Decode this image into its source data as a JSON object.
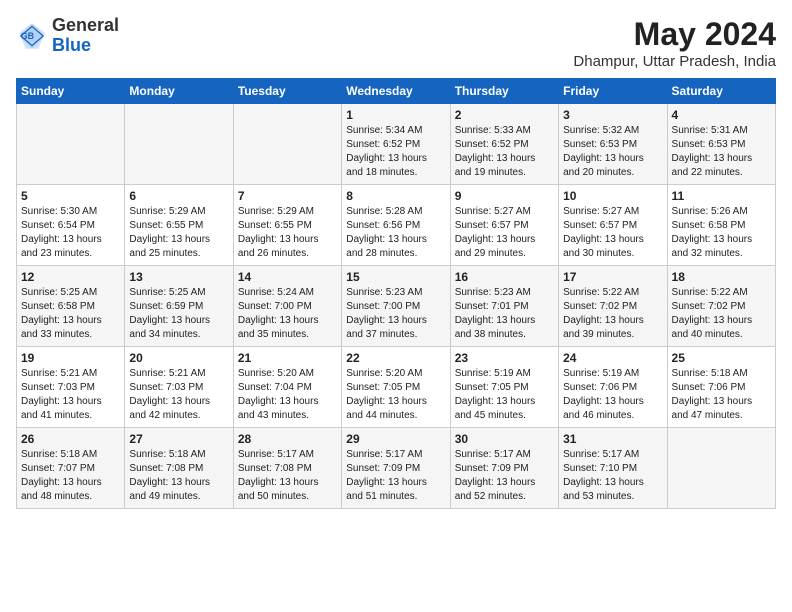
{
  "header": {
    "logo_general": "General",
    "logo_blue": "Blue",
    "month_title": "May 2024",
    "location": "Dhampur, Uttar Pradesh, India"
  },
  "weekdays": [
    "Sunday",
    "Monday",
    "Tuesday",
    "Wednesday",
    "Thursday",
    "Friday",
    "Saturday"
  ],
  "weeks": [
    [
      {
        "day": "",
        "info": ""
      },
      {
        "day": "",
        "info": ""
      },
      {
        "day": "",
        "info": ""
      },
      {
        "day": "1",
        "info": "Sunrise: 5:34 AM\nSunset: 6:52 PM\nDaylight: 13 hours\nand 18 minutes."
      },
      {
        "day": "2",
        "info": "Sunrise: 5:33 AM\nSunset: 6:52 PM\nDaylight: 13 hours\nand 19 minutes."
      },
      {
        "day": "3",
        "info": "Sunrise: 5:32 AM\nSunset: 6:53 PM\nDaylight: 13 hours\nand 20 minutes."
      },
      {
        "day": "4",
        "info": "Sunrise: 5:31 AM\nSunset: 6:53 PM\nDaylight: 13 hours\nand 22 minutes."
      }
    ],
    [
      {
        "day": "5",
        "info": "Sunrise: 5:30 AM\nSunset: 6:54 PM\nDaylight: 13 hours\nand 23 minutes."
      },
      {
        "day": "6",
        "info": "Sunrise: 5:29 AM\nSunset: 6:55 PM\nDaylight: 13 hours\nand 25 minutes."
      },
      {
        "day": "7",
        "info": "Sunrise: 5:29 AM\nSunset: 6:55 PM\nDaylight: 13 hours\nand 26 minutes."
      },
      {
        "day": "8",
        "info": "Sunrise: 5:28 AM\nSunset: 6:56 PM\nDaylight: 13 hours\nand 28 minutes."
      },
      {
        "day": "9",
        "info": "Sunrise: 5:27 AM\nSunset: 6:57 PM\nDaylight: 13 hours\nand 29 minutes."
      },
      {
        "day": "10",
        "info": "Sunrise: 5:27 AM\nSunset: 6:57 PM\nDaylight: 13 hours\nand 30 minutes."
      },
      {
        "day": "11",
        "info": "Sunrise: 5:26 AM\nSunset: 6:58 PM\nDaylight: 13 hours\nand 32 minutes."
      }
    ],
    [
      {
        "day": "12",
        "info": "Sunrise: 5:25 AM\nSunset: 6:58 PM\nDaylight: 13 hours\nand 33 minutes."
      },
      {
        "day": "13",
        "info": "Sunrise: 5:25 AM\nSunset: 6:59 PM\nDaylight: 13 hours\nand 34 minutes."
      },
      {
        "day": "14",
        "info": "Sunrise: 5:24 AM\nSunset: 7:00 PM\nDaylight: 13 hours\nand 35 minutes."
      },
      {
        "day": "15",
        "info": "Sunrise: 5:23 AM\nSunset: 7:00 PM\nDaylight: 13 hours\nand 37 minutes."
      },
      {
        "day": "16",
        "info": "Sunrise: 5:23 AM\nSunset: 7:01 PM\nDaylight: 13 hours\nand 38 minutes."
      },
      {
        "day": "17",
        "info": "Sunrise: 5:22 AM\nSunset: 7:02 PM\nDaylight: 13 hours\nand 39 minutes."
      },
      {
        "day": "18",
        "info": "Sunrise: 5:22 AM\nSunset: 7:02 PM\nDaylight: 13 hours\nand 40 minutes."
      }
    ],
    [
      {
        "day": "19",
        "info": "Sunrise: 5:21 AM\nSunset: 7:03 PM\nDaylight: 13 hours\nand 41 minutes."
      },
      {
        "day": "20",
        "info": "Sunrise: 5:21 AM\nSunset: 7:03 PM\nDaylight: 13 hours\nand 42 minutes."
      },
      {
        "day": "21",
        "info": "Sunrise: 5:20 AM\nSunset: 7:04 PM\nDaylight: 13 hours\nand 43 minutes."
      },
      {
        "day": "22",
        "info": "Sunrise: 5:20 AM\nSunset: 7:05 PM\nDaylight: 13 hours\nand 44 minutes."
      },
      {
        "day": "23",
        "info": "Sunrise: 5:19 AM\nSunset: 7:05 PM\nDaylight: 13 hours\nand 45 minutes."
      },
      {
        "day": "24",
        "info": "Sunrise: 5:19 AM\nSunset: 7:06 PM\nDaylight: 13 hours\nand 46 minutes."
      },
      {
        "day": "25",
        "info": "Sunrise: 5:18 AM\nSunset: 7:06 PM\nDaylight: 13 hours\nand 47 minutes."
      }
    ],
    [
      {
        "day": "26",
        "info": "Sunrise: 5:18 AM\nSunset: 7:07 PM\nDaylight: 13 hours\nand 48 minutes."
      },
      {
        "day": "27",
        "info": "Sunrise: 5:18 AM\nSunset: 7:08 PM\nDaylight: 13 hours\nand 49 minutes."
      },
      {
        "day": "28",
        "info": "Sunrise: 5:17 AM\nSunset: 7:08 PM\nDaylight: 13 hours\nand 50 minutes."
      },
      {
        "day": "29",
        "info": "Sunrise: 5:17 AM\nSunset: 7:09 PM\nDaylight: 13 hours\nand 51 minutes."
      },
      {
        "day": "30",
        "info": "Sunrise: 5:17 AM\nSunset: 7:09 PM\nDaylight: 13 hours\nand 52 minutes."
      },
      {
        "day": "31",
        "info": "Sunrise: 5:17 AM\nSunset: 7:10 PM\nDaylight: 13 hours\nand 53 minutes."
      },
      {
        "day": "",
        "info": ""
      }
    ]
  ]
}
